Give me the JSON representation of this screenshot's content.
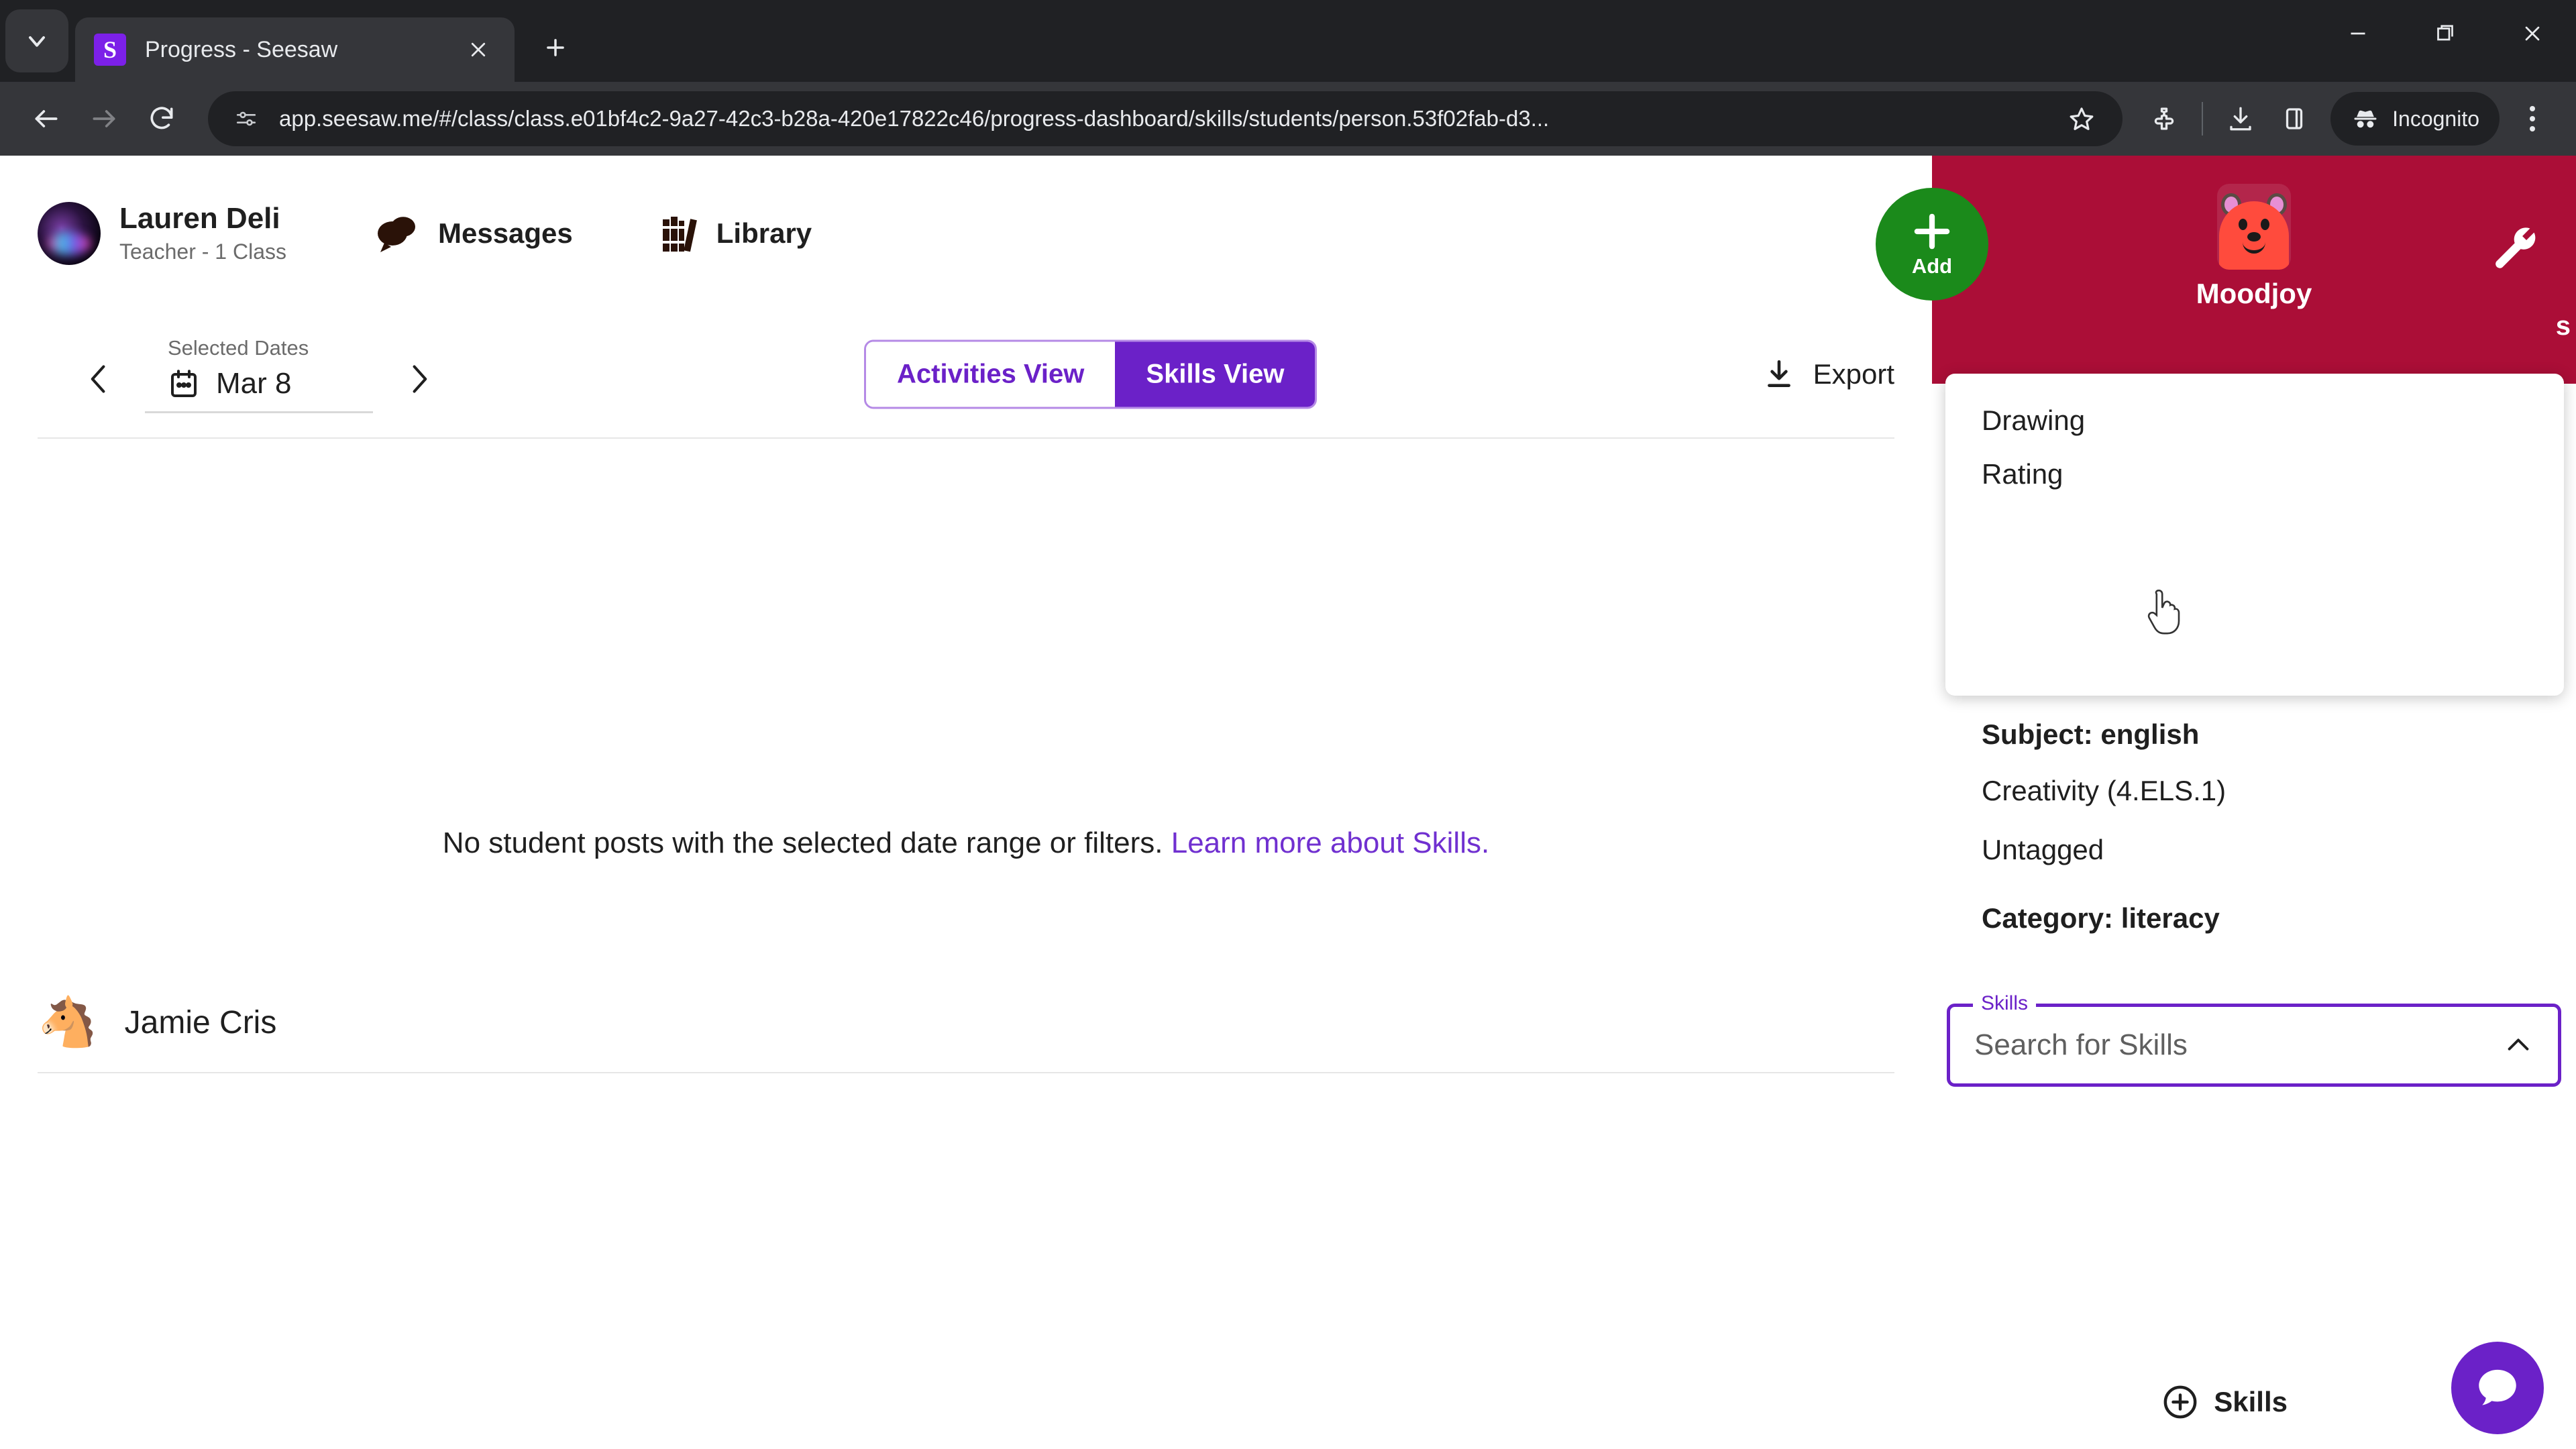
{
  "browser": {
    "tab": {
      "title": "Progress - Seesaw",
      "favicon_letter": "S"
    },
    "tab_list_icon": "chevron-down-icon",
    "new_tab_icon": "plus-icon",
    "window": {
      "minimize": "minimize-icon",
      "maximize": "maximize-icon",
      "close": "close-icon"
    },
    "nav": {
      "back": "back-arrow-icon",
      "forward": "forward-arrow-icon",
      "reload": "reload-icon"
    },
    "omnibox": {
      "site_info_icon": "site-settings-icon",
      "url": "app.seesaw.me/#/class/class.e01bf4c2-9a27-42c3-b28a-420e17822c46/progress-dashboard/skills/students/person.53f02fab-d3...",
      "bookmark_icon": "star-icon"
    },
    "toolbar_icons": [
      "extensions-icon",
      "downloads-icon",
      "side-panel-icon"
    ],
    "incognito": {
      "label": "Incognito",
      "icon": "incognito-icon"
    },
    "menu_icon": "three-dot-menu-icon"
  },
  "app_header": {
    "user_name": "Lauren Deli",
    "user_role": "Teacher - 1 Class",
    "avatar_icon": "user-avatar",
    "links": [
      {
        "label": "Messages",
        "icon": "chat-bubbles-icon"
      },
      {
        "label": "Library",
        "icon": "books-icon"
      }
    ]
  },
  "class_panel": {
    "add_button": {
      "label": "Add",
      "icon": "plus-icon"
    },
    "mascot_name": "Moodjoy",
    "mascot_icon": "rainbow-bear-avatar",
    "settings_icon": "wrench-icon",
    "edge_text": "s",
    "accent_color": "#ab0e37",
    "add_button_color": "#1b8a1b"
  },
  "controls": {
    "date": {
      "label": "Selected Dates",
      "value": "Mar 8",
      "calendar_icon": "calendar-icon",
      "prev_icon": "chevron-left-icon",
      "next_icon": "chevron-right-icon"
    },
    "view_toggle": {
      "options": [
        "Activities View",
        "Skills View"
      ],
      "active": "Skills View",
      "active_color": "#6b21c8"
    },
    "export": {
      "label": "Export",
      "icon": "download-icon"
    }
  },
  "main": {
    "empty_state_text": "No student posts with the selected date range or filters.",
    "empty_state_link": "Learn more about Skills.",
    "link_color": "#7030d0",
    "students": [
      {
        "name": "Jamie Cris",
        "avatar_icon": "horse-emoji-avatar",
        "avatar_glyph": "🐴"
      }
    ]
  },
  "skills_filter": {
    "dropdown_items": [
      "Drawing",
      "Rating"
    ],
    "groups": [
      {
        "title": "Subject: english",
        "items": [
          "Creativity (4.ELS.1)",
          "Untagged"
        ]
      },
      {
        "title": "Category: literacy",
        "items": []
      }
    ],
    "combobox": {
      "legend": "Skills",
      "placeholder": "Search for Skills",
      "chevron_icon": "chevron-up-icon",
      "border_color": "#6b21c8"
    }
  },
  "footer": {
    "skills_button": {
      "label": "Skills",
      "icon": "plus-circle-icon"
    },
    "chat_fab": {
      "icon": "chat-bubble-icon",
      "color": "#6b21c8"
    }
  }
}
